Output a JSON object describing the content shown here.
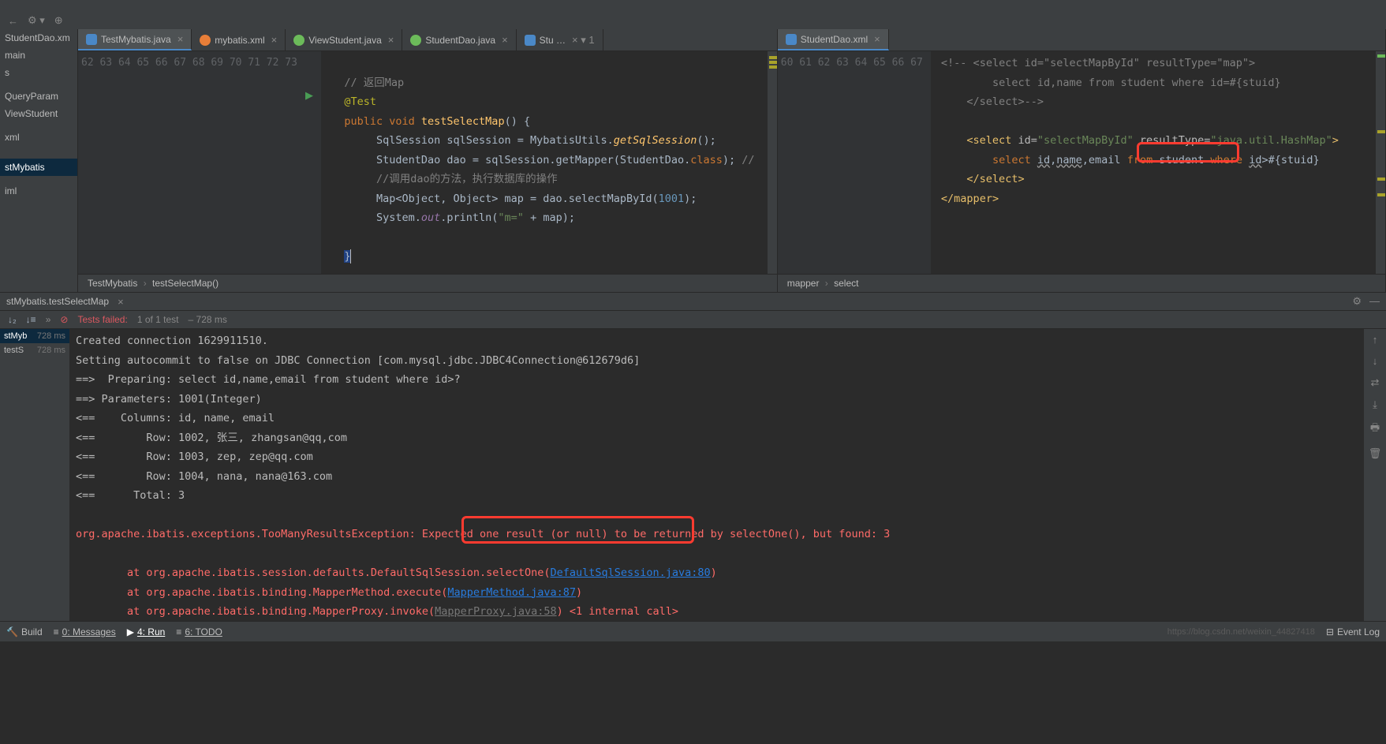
{
  "toolbar": {
    "run_config": "TestMybatis.testSelectMap"
  },
  "project_tree": {
    "items": [
      "StudentDao.xm",
      "main",
      "s",
      "",
      "QueryParam",
      "ViewStudent",
      "",
      "xml",
      "",
      "",
      "stMybatis",
      "",
      "iml"
    ],
    "selected_index": 10
  },
  "editor_left": {
    "tabs": [
      {
        "label": "TestMybatis.java",
        "icon": "java",
        "active": true
      },
      {
        "label": "mybatis.xml",
        "icon": "xml-o",
        "active": false
      },
      {
        "label": "ViewStudent.java",
        "icon": "xml-g",
        "active": false
      },
      {
        "label": "StudentDao.java",
        "icon": "xml-g",
        "active": false
      },
      {
        "label": "Stu …",
        "icon": "xml-r",
        "active": false,
        "more": "1"
      }
    ],
    "line_start": 62,
    "line_end": 73,
    "breadcrumb": [
      "TestMybatis",
      "testSelectMap()"
    ]
  },
  "editor_right": {
    "tabs": [
      {
        "label": "StudentDao.xml",
        "icon": "xml-r",
        "active": true
      }
    ],
    "line_start": 60,
    "line_end": 67,
    "breadcrumb": [
      "mapper",
      "select"
    ]
  },
  "code_left": {
    "comment1": "// 返回Map",
    "anno": "@Test",
    "line3": {
      "kw1": "public",
      "kw2": "void",
      "fn": "testSelectMap",
      "brace": "() {"
    },
    "line4": {
      "p1": "SqlSession sqlSession = MybatisUtils.",
      "m": "getSqlSession",
      "p2": "();"
    },
    "line5": {
      "p1": "StudentDao dao = sqlSession.getMapper(StudentDao.",
      "kw": "class",
      "p2": "); ",
      "com": "//"
    },
    "line6_com": "//调用dao的方法，执行数据库的操作",
    "line7": {
      "p1": "Map<Object, Object> map = dao.selectMapById(",
      "num": "1001",
      "p2": ");"
    },
    "line8": {
      "p1": "System.",
      "fld": "out",
      "p2": ".println(",
      "str": "\"m=\"",
      "p3": " + map);"
    },
    "close_brace": "}"
  },
  "code_right": {
    "line1_com": "<!-- <select id=\"selectMapById\" resultType=\"map\">",
    "line2_com": "select id,name from student where id=#{stuid}",
    "line3_com": "</select>-->",
    "line5": {
      "t1": "<select",
      "a1": "id=",
      "v1": "\"selectMapById\"",
      "a2": "resultType=",
      "v2": "\"java.util.HashMap\"",
      "t2": ">"
    },
    "line6": {
      "kw1": "select",
      "c1": "id",
      "c2": "name",
      "col3": "email",
      "kw2": "from",
      "tbl": "student",
      "kw3": "where",
      "c3": "id",
      "gt": ">",
      "param": "#{stuid}"
    },
    "line7": "</select>",
    "line8": "</mapper>"
  },
  "run_panel": {
    "tab_label": "stMybatis.testSelectMap",
    "test_status": {
      "prefix": "Tests failed:",
      "count": "1 of 1 test",
      "time": "– 728 ms"
    },
    "tree": [
      {
        "name": "stMyb",
        "time": "728 ms"
      },
      {
        "name": "testS",
        "time": "728 ms"
      }
    ]
  },
  "console": {
    "l1": "Created connection 1629911510.",
    "l2": "Setting autocommit to false on JDBC Connection [com.mysql.jdbc.JDBC4Connection@612679d6]",
    "l3": "==>  Preparing: select id,name,email from student where id>?",
    "l4": "==> Parameters: 1001(Integer)",
    "l5": "<==    Columns: id, name, email",
    "l6": "<==        Row: 1002, 张三, zhangsan@qq,com",
    "l7": "<==        Row: 1003, zep, zep@qq.com",
    "l8": "<==        Row: 1004, nana, nana@163.com",
    "l9": "<==      Total: 3",
    "err_pre": "org.apache.ibatis.exceptions.TooManyResultsException: ",
    "err_hl": "Expected one result (or null) ",
    "err_post": "to be returned by selectOne(), but found: 3",
    "st1_pre": "\tat org.apache.ibatis.session.defaults.DefaultSqlSession.selectOne(",
    "st1_link": "DefaultSqlSession.java:80",
    "st2_pre": "\tat org.apache.ibatis.binding.MapperMethod.execute(",
    "st2_link": "MapperMethod.java:87",
    "st3_pre": "\tat org.apache.ibatis.binding.MapperProxy.invoke(",
    "st3_link": "MapperProxy.java:58",
    "st3_post": ") <1 internal call>",
    "close_p": ")"
  },
  "status_bar": {
    "build": "Build",
    "messages": "0: Messages",
    "run": "4: Run",
    "todo": "6: TODO",
    "event_log": "Event Log",
    "watermark": "https://blog.csdn.net/weixin_44827418"
  }
}
